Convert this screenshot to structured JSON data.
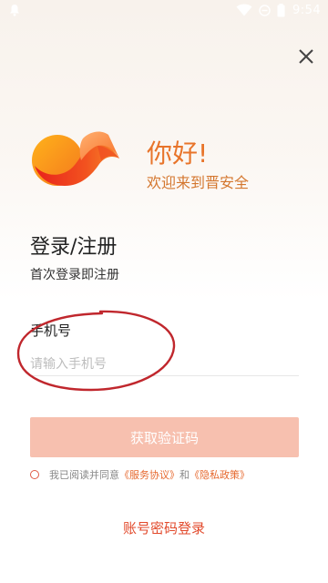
{
  "status_bar": {
    "time": "9:54",
    "icons": [
      "notification-icon",
      "wifi-icon",
      "do-not-disturb-icon",
      "battery-icon"
    ]
  },
  "close_icon": "close-icon",
  "header": {
    "greeting": "你好!",
    "welcome": "欢迎来到晋安全"
  },
  "login": {
    "title": "登录/注册",
    "subtitle": "首次登录即注册"
  },
  "phone": {
    "label": "手机号",
    "placeholder": "请输入手机号",
    "value": ""
  },
  "get_code_button": "获取验证码",
  "agreement": {
    "checked": false,
    "prefix": "我已阅读并同意",
    "service_link": "《服务协议》",
    "conjunction": "和",
    "privacy_link": "《隐私政策》"
  },
  "password_login_link": "账号密码登录",
  "colors": {
    "accent": "#e8742a",
    "button_disabled": "#f7c0af",
    "link": "#e6692f",
    "secondary_link": "#e24a2c",
    "annotation": "#c0272d"
  }
}
